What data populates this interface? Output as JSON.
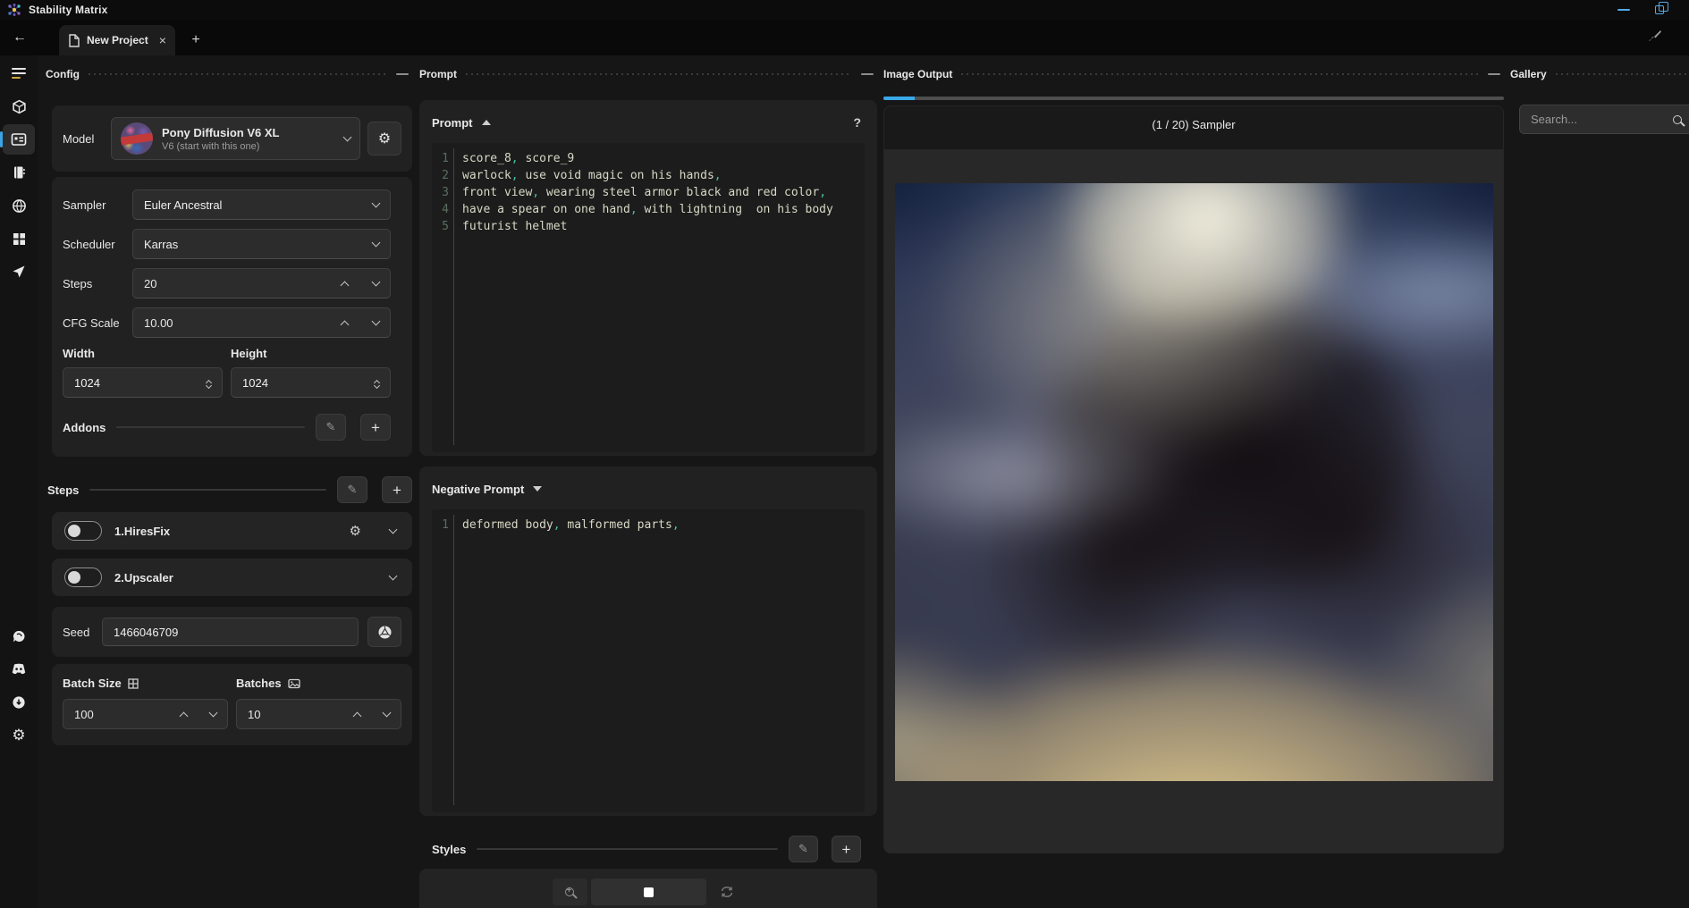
{
  "titlebar": {
    "app_title": "Stability Matrix"
  },
  "tabbar": {
    "active_tab": "New Project"
  },
  "sidebar": {
    "active_item": "inference"
  },
  "config": {
    "header": "Config",
    "model": {
      "label": "Model",
      "name": "Pony Diffusion V6 XL",
      "subtitle": "V6 (start with this one)"
    },
    "sampler": {
      "label": "Sampler",
      "value": "Euler Ancestral"
    },
    "scheduler": {
      "label": "Scheduler",
      "value": "Karras"
    },
    "steps": {
      "label": "Steps",
      "value": "20"
    },
    "cfg_scale": {
      "label": "CFG Scale",
      "value": "10.00"
    },
    "dimensions": {
      "width_label": "Width",
      "width_value": "1024",
      "height_label": "Height",
      "height_value": "1024"
    },
    "addons": {
      "label": "Addons"
    },
    "steps_section": {
      "label": "Steps",
      "modules": [
        {
          "label": "1.HiresFix",
          "enabled": false
        },
        {
          "label": "2.Upscaler",
          "enabled": false
        }
      ]
    },
    "seed": {
      "label": "Seed",
      "value": "1466046709"
    },
    "batch": {
      "size_label": "Batch Size",
      "size_value": "100",
      "batches_label": "Batches",
      "batches_value": "10"
    }
  },
  "prompt_panel": {
    "header": "Prompt",
    "positive": {
      "title": "Prompt",
      "help_label": "?",
      "lines": [
        "score_8, score_9",
        "warlock, use void magic on his hands,",
        "front view, wearing steel armor black and red color,",
        "have a spear on one hand, with lightning  on his body",
        "futurist helmet"
      ]
    },
    "negative": {
      "title": "Negative Prompt",
      "lines": [
        "deformed body, malformed parts,"
      ]
    },
    "styles_label": "Styles"
  },
  "output_panel": {
    "header": "Image Output",
    "status": "(1 / 20) Sampler",
    "progress_percent": 5,
    "accent_color": "#38a8e8"
  },
  "gallery": {
    "header": "Gallery",
    "search_placeholder": "Search..."
  }
}
